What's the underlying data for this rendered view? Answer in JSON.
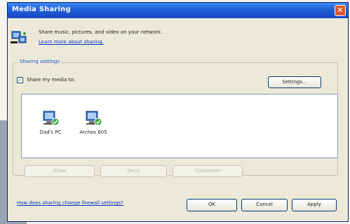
{
  "window": {
    "title": "Media Sharing"
  },
  "header": {
    "description": "Share music, pictures, and video on your network.",
    "learn_more": "Learn more about sharing."
  },
  "sharing_settings": {
    "group_label": "Sharing settings",
    "share_media_label": "Share my media to:",
    "share_media_checked": true,
    "settings_button": "Settings...",
    "devices": [
      {
        "name": "Dad's PC",
        "icon": "computer-shared-icon"
      },
      {
        "name": "Archos 605",
        "icon": "media-device-shared-icon"
      }
    ],
    "allow_button": "Allow",
    "deny_button": "Deny",
    "customize_button": "Customize"
  },
  "footer": {
    "help_link": "How does sharing change firewall settings?",
    "ok_button": "OK",
    "cancel_button": "Cancel",
    "apply_button": "Apply"
  },
  "colors": {
    "titlebar": "#1f5fd6",
    "dialog_bg": "#ece9d8",
    "link": "#0b34c8"
  }
}
